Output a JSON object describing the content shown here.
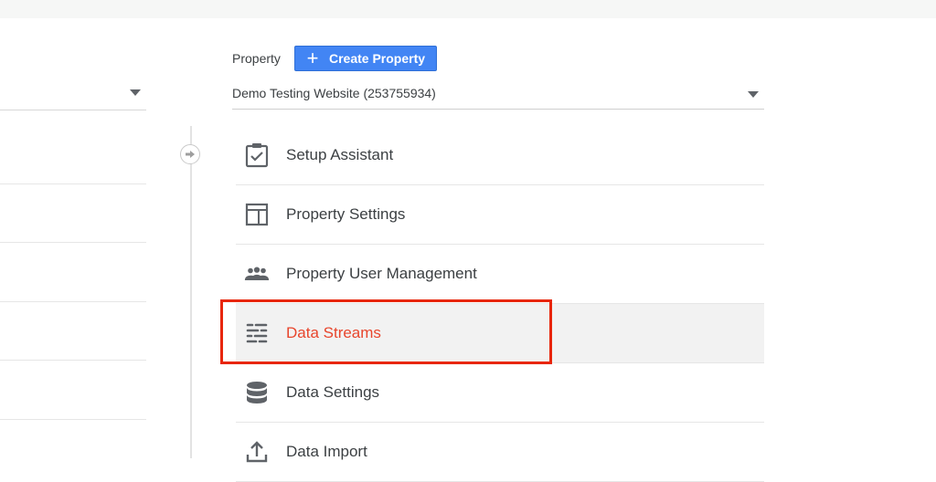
{
  "property_panel": {
    "label": "Property",
    "create_button": "Create Property",
    "selected_property": "Demo Testing Website (253755934)",
    "menu": [
      {
        "label": "Setup Assistant",
        "icon": "clipboard-check-icon"
      },
      {
        "label": "Property Settings",
        "icon": "layout-icon"
      },
      {
        "label": "Property User Management",
        "icon": "people-group-icon"
      },
      {
        "label": "Data Streams",
        "icon": "data-streams-icon",
        "active": true
      },
      {
        "label": "Data Settings",
        "icon": "database-icon"
      },
      {
        "label": "Data Import",
        "icon": "upload-icon"
      }
    ]
  },
  "colors": {
    "button_blue": "#4285f4",
    "active_text": "#e8452c",
    "highlight_box": "#e8260b",
    "icon_gray": "#5f6368"
  }
}
